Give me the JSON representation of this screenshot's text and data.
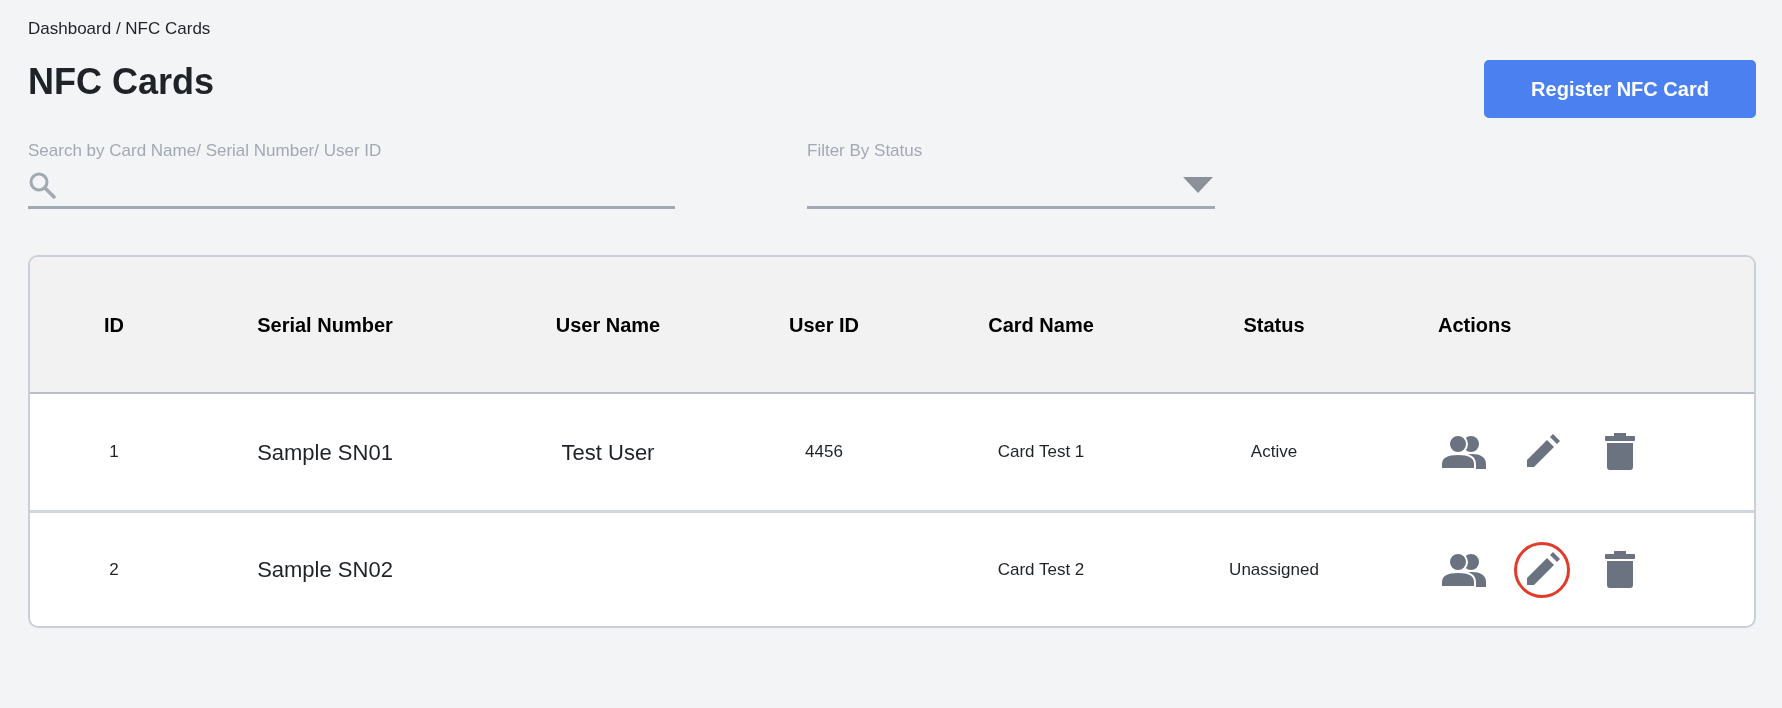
{
  "breadcrumb": "Dashboard / NFC Cards",
  "title": "NFC Cards",
  "register_button": "Register NFC Card",
  "search": {
    "label": "Search by Card Name/ Serial Number/ User ID"
  },
  "filter": {
    "label": "Filter By Status"
  },
  "table": {
    "columns": [
      "ID",
      "Serial Number",
      "User Name",
      "User ID",
      "Card Name",
      "Status",
      "Actions"
    ],
    "rows": [
      {
        "id": "1",
        "serial_number": "Sample SN01",
        "user_name": "Test User",
        "user_id": "4456",
        "card_name": "Card Test 1",
        "status": "Active",
        "actions": [
          {
            "kind": "users",
            "highlighted": false
          },
          {
            "kind": "edit",
            "highlighted": false
          },
          {
            "kind": "delete",
            "highlighted": false
          }
        ]
      },
      {
        "id": "2",
        "serial_number": "Sample SN02",
        "card_name": "Card Test 2",
        "status": "Unassigned",
        "actions": [
          {
            "kind": "users",
            "highlighted": false
          },
          {
            "kind": "edit",
            "highlighted": true
          },
          {
            "kind": "delete",
            "highlighted": false
          }
        ]
      }
    ]
  }
}
